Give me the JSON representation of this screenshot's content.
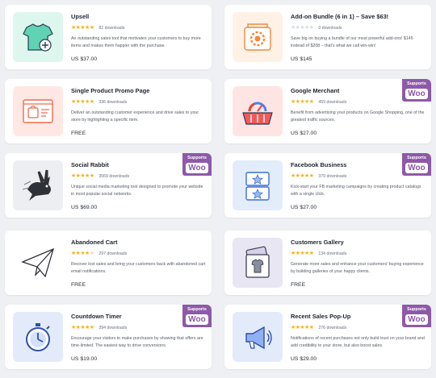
{
  "badge": {
    "supports": "Supports",
    "woo": "Woo"
  },
  "products": [
    {
      "title": "Upsell",
      "downloads": "82 downloads",
      "description": "An outstanding sales tool that motivates your customers to buy more items and makes them happier with the purchase.",
      "price": "US $37.00",
      "icon": "tshirt-plus-icon",
      "woo": false
    },
    {
      "title": "Add-on Bundle (6 in 1) – Save $63!",
      "downloads": "0 downloads",
      "description": "Save big on buying a bundle of our most powerful add-ons! $145 instead of $208 – that's what we call win-win!",
      "price": "US $145",
      "icon": "gear-box-icon",
      "woo": false
    },
    {
      "title": "Single Product Promo Page",
      "downloads": "336 downloads",
      "description": "Deliver an outstanding customer experience and drive sales to your store by highlighting a specific item.",
      "price": "FREE",
      "icon": "shopping-bag-browser-icon",
      "woo": false
    },
    {
      "title": "Google Merchant",
      "downloads": "459 downloads",
      "description": "Benefit from advertising your products on Google Shopping, one of the greatest traffic sources.",
      "price": "US $27.00",
      "icon": "google-basket-icon",
      "woo": true
    },
    {
      "title": "Social Rabbit",
      "downloads": "3569 downloads",
      "description": "Unique social media marketing tool designed to promote your website in most popular social networks.",
      "price": "US $69.00",
      "icon": "rabbit-icon",
      "woo": true
    },
    {
      "title": "Facebook Business",
      "downloads": "379 downloads",
      "description": "Kick-start your FB marketing campaigns by creating product catalogs with a single click.",
      "price": "US $27.00",
      "icon": "star-catalog-icon",
      "woo": true
    },
    {
      "title": "Abandoned Cart",
      "downloads": "297 downloads",
      "description": "Recover lost sales and bring your customers back with abandoned cart email notifications.",
      "price": "FREE",
      "icon": "paper-plane-icon",
      "woo": false
    },
    {
      "title": "Customers Gallery",
      "downloads": "134 downloads",
      "description": "Generate more sales and enhance your customers' buying experience by building galleries of your happy clients.",
      "price": "FREE",
      "icon": "gallery-icon",
      "woo": false
    },
    {
      "title": "Countdown Timer",
      "downloads": "394 downloads",
      "description": "Encourage your visitors to make purchases by showing that offers are time-limited. The easiest way to drive conversions.",
      "price": "US $19.00",
      "icon": "stopwatch-icon",
      "woo": true
    },
    {
      "title": "Recent Sales Pop-Up",
      "downloads": "276 downloads",
      "description": "Notifications of recent purchases not only build trust on your brand and add credibility to your store, but also boost sales.",
      "price": "US $29.00",
      "icon": "megaphone-icon",
      "woo": true
    }
  ]
}
